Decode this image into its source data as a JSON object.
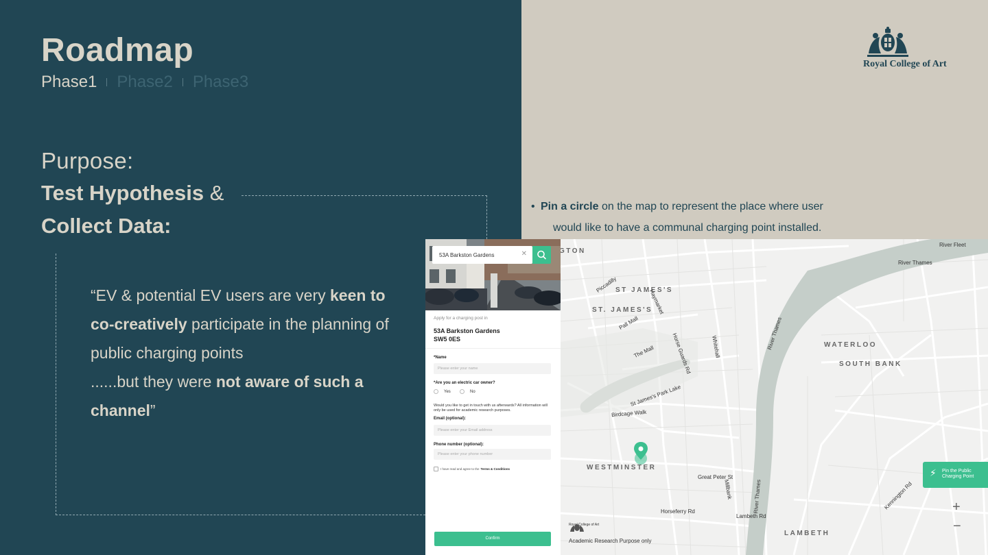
{
  "title": "Roadmap",
  "phases": [
    "Phase1",
    "Phase2",
    "Phase3"
  ],
  "purpose": {
    "label": "Purpose:",
    "line1_bold": "Test Hypothesis",
    "line1_rest": " &",
    "line2": "Collect Data:"
  },
  "quote": {
    "p1": "“EV & potential EV users are very ",
    "b1": "keen to co-creatively",
    "p2": " participate in the planning of public charging points",
    "p3": "......but they were ",
    "b2": "not aware of such a channel",
    "p4": "”"
  },
  "logo": {
    "text": "Royal College of Art"
  },
  "bullet": {
    "bold": "Pin a circle",
    "rest1": " on the map to represent the place where user",
    "rest2": "would like to have a communal charging point installed."
  },
  "form": {
    "search_value": "53A Barkston  Gardens",
    "subtitle": "Apply for a charging post in",
    "address_line1": "53A Barkston Gardens",
    "address_line2": "SW5 0ES",
    "name_label": "*Name",
    "name_placeholder": "Please enter your name",
    "owner_label": "*Are you an electric car owner?",
    "yes": "Yes",
    "no": "No",
    "note": "Would you like to get in touch with us afterwards? All information will only be used for academic research purposes.",
    "email_label": "Email (optional):",
    "email_placeholder": "Please enter your Email address",
    "phone_label": "Phone number (optional):",
    "phone_placeholder": "Please enter your phone number",
    "terms_prefix": "I have read and agree to the",
    "terms_link": "Terms & Conditions",
    "confirm": "Confirm"
  },
  "map": {
    "areas": [
      "ST JAMES'S",
      "ST. JAMES'S",
      "WATERLOO",
      "SOUTH BANK",
      "WESTMINSTER",
      "LAMBETH",
      "GTON"
    ],
    "labels": [
      "River Fleet",
      "River Thames",
      "River Thames",
      "River Thames",
      "St James's Park Lake",
      "Birdcage Walk",
      "The Mall",
      "Pall Mall",
      "Piccadilly",
      "Haymarket",
      "Whitehall",
      "Horse Guards Rd",
      "Great Peter St",
      "Horseferry Rd",
      "Lambeth Rd",
      "Millbank",
      "Kennington Rd"
    ],
    "pin_button": "Pin the Public Charging Point",
    "zoom_in": "+",
    "zoom_out": "−",
    "footer_logo": "Royal College of Art",
    "footer": "Academic Research Purpose only"
  }
}
